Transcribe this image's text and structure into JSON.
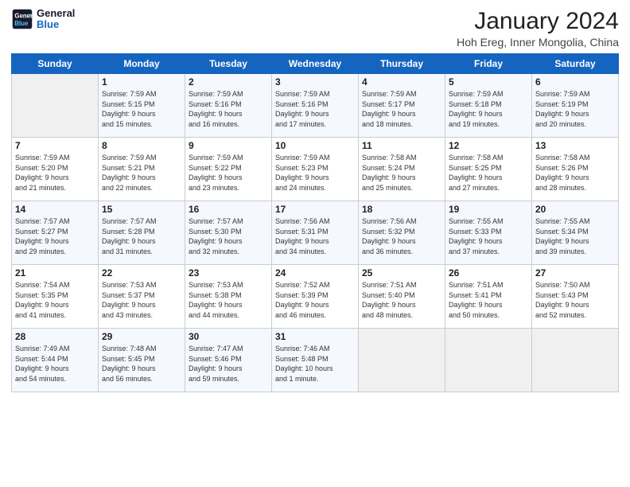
{
  "logo": {
    "line1": "General",
    "line2": "Blue"
  },
  "title": "January 2024",
  "subtitle": "Hoh Ereg, Inner Mongolia, China",
  "days_of_week": [
    "Sunday",
    "Monday",
    "Tuesday",
    "Wednesday",
    "Thursday",
    "Friday",
    "Saturday"
  ],
  "weeks": [
    [
      {
        "day": "",
        "content": ""
      },
      {
        "day": "1",
        "content": "Sunrise: 7:59 AM\nSunset: 5:15 PM\nDaylight: 9 hours\nand 15 minutes."
      },
      {
        "day": "2",
        "content": "Sunrise: 7:59 AM\nSunset: 5:16 PM\nDaylight: 9 hours\nand 16 minutes."
      },
      {
        "day": "3",
        "content": "Sunrise: 7:59 AM\nSunset: 5:16 PM\nDaylight: 9 hours\nand 17 minutes."
      },
      {
        "day": "4",
        "content": "Sunrise: 7:59 AM\nSunset: 5:17 PM\nDaylight: 9 hours\nand 18 minutes."
      },
      {
        "day": "5",
        "content": "Sunrise: 7:59 AM\nSunset: 5:18 PM\nDaylight: 9 hours\nand 19 minutes."
      },
      {
        "day": "6",
        "content": "Sunrise: 7:59 AM\nSunset: 5:19 PM\nDaylight: 9 hours\nand 20 minutes."
      }
    ],
    [
      {
        "day": "7",
        "content": "Sunrise: 7:59 AM\nSunset: 5:20 PM\nDaylight: 9 hours\nand 21 minutes."
      },
      {
        "day": "8",
        "content": "Sunrise: 7:59 AM\nSunset: 5:21 PM\nDaylight: 9 hours\nand 22 minutes."
      },
      {
        "day": "9",
        "content": "Sunrise: 7:59 AM\nSunset: 5:22 PM\nDaylight: 9 hours\nand 23 minutes."
      },
      {
        "day": "10",
        "content": "Sunrise: 7:59 AM\nSunset: 5:23 PM\nDaylight: 9 hours\nand 24 minutes."
      },
      {
        "day": "11",
        "content": "Sunrise: 7:58 AM\nSunset: 5:24 PM\nDaylight: 9 hours\nand 25 minutes."
      },
      {
        "day": "12",
        "content": "Sunrise: 7:58 AM\nSunset: 5:25 PM\nDaylight: 9 hours\nand 27 minutes."
      },
      {
        "day": "13",
        "content": "Sunrise: 7:58 AM\nSunset: 5:26 PM\nDaylight: 9 hours\nand 28 minutes."
      }
    ],
    [
      {
        "day": "14",
        "content": "Sunrise: 7:57 AM\nSunset: 5:27 PM\nDaylight: 9 hours\nand 29 minutes."
      },
      {
        "day": "15",
        "content": "Sunrise: 7:57 AM\nSunset: 5:28 PM\nDaylight: 9 hours\nand 31 minutes."
      },
      {
        "day": "16",
        "content": "Sunrise: 7:57 AM\nSunset: 5:30 PM\nDaylight: 9 hours\nand 32 minutes."
      },
      {
        "day": "17",
        "content": "Sunrise: 7:56 AM\nSunset: 5:31 PM\nDaylight: 9 hours\nand 34 minutes."
      },
      {
        "day": "18",
        "content": "Sunrise: 7:56 AM\nSunset: 5:32 PM\nDaylight: 9 hours\nand 36 minutes."
      },
      {
        "day": "19",
        "content": "Sunrise: 7:55 AM\nSunset: 5:33 PM\nDaylight: 9 hours\nand 37 minutes."
      },
      {
        "day": "20",
        "content": "Sunrise: 7:55 AM\nSunset: 5:34 PM\nDaylight: 9 hours\nand 39 minutes."
      }
    ],
    [
      {
        "day": "21",
        "content": "Sunrise: 7:54 AM\nSunset: 5:35 PM\nDaylight: 9 hours\nand 41 minutes."
      },
      {
        "day": "22",
        "content": "Sunrise: 7:53 AM\nSunset: 5:37 PM\nDaylight: 9 hours\nand 43 minutes."
      },
      {
        "day": "23",
        "content": "Sunrise: 7:53 AM\nSunset: 5:38 PM\nDaylight: 9 hours\nand 44 minutes."
      },
      {
        "day": "24",
        "content": "Sunrise: 7:52 AM\nSunset: 5:39 PM\nDaylight: 9 hours\nand 46 minutes."
      },
      {
        "day": "25",
        "content": "Sunrise: 7:51 AM\nSunset: 5:40 PM\nDaylight: 9 hours\nand 48 minutes."
      },
      {
        "day": "26",
        "content": "Sunrise: 7:51 AM\nSunset: 5:41 PM\nDaylight: 9 hours\nand 50 minutes."
      },
      {
        "day": "27",
        "content": "Sunrise: 7:50 AM\nSunset: 5:43 PM\nDaylight: 9 hours\nand 52 minutes."
      }
    ],
    [
      {
        "day": "28",
        "content": "Sunrise: 7:49 AM\nSunset: 5:44 PM\nDaylight: 9 hours\nand 54 minutes."
      },
      {
        "day": "29",
        "content": "Sunrise: 7:48 AM\nSunset: 5:45 PM\nDaylight: 9 hours\nand 56 minutes."
      },
      {
        "day": "30",
        "content": "Sunrise: 7:47 AM\nSunset: 5:46 PM\nDaylight: 9 hours\nand 59 minutes."
      },
      {
        "day": "31",
        "content": "Sunrise: 7:46 AM\nSunset: 5:48 PM\nDaylight: 10 hours\nand 1 minute."
      },
      {
        "day": "",
        "content": ""
      },
      {
        "day": "",
        "content": ""
      },
      {
        "day": "",
        "content": ""
      }
    ]
  ]
}
